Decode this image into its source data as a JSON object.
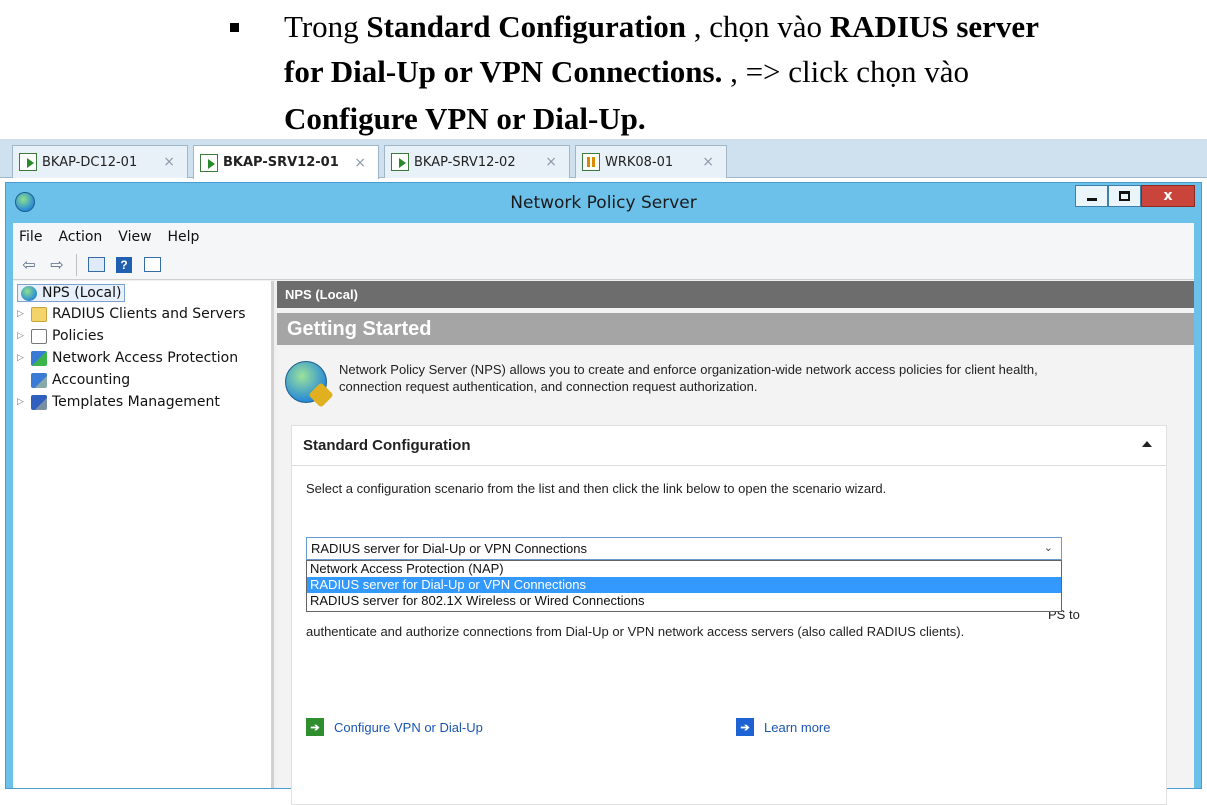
{
  "document": {
    "line1": {
      "t1": "Trong ",
      "b1": "Standard Configuration",
      "t2": " , chọn vào ",
      "b2": "RADIUS server"
    },
    "line2": {
      "b1": "for Dial-Up or VPN Connections.",
      "t1": " , => click chọn vào"
    },
    "line3": {
      "b1": "Configure VPN or Dial-Up."
    }
  },
  "vm_tabs": [
    {
      "label": "BKAP-DC12-01",
      "active": false,
      "state": "running"
    },
    {
      "label": "BKAP-SRV12-01",
      "active": true,
      "state": "running"
    },
    {
      "label": "BKAP-SRV12-02",
      "active": false,
      "state": "running"
    },
    {
      "label": "WRK08-01",
      "active": false,
      "state": "paused"
    }
  ],
  "tab_close_glyph": "×",
  "window": {
    "title": "Network Policy Server",
    "icon": "globe-icon",
    "controls": {
      "close_label": "x"
    }
  },
  "menu": [
    "File",
    "Action",
    "View",
    "Help"
  ],
  "toolbar_icons": [
    "back-arrow-icon",
    "forward-arrow-icon",
    "show-hide-console-tree-icon",
    "help-icon",
    "show-hide-action-pane-icon"
  ],
  "toolbar_glyphs": {
    "back": "⇦",
    "forward": "⇨",
    "help": "?"
  },
  "tree": {
    "root": "NPS (Local)",
    "items": [
      {
        "label": "RADIUS Clients and Servers",
        "icon": "folder-icon",
        "expandable": true
      },
      {
        "label": "Policies",
        "icon": "policies-icon",
        "expandable": true
      },
      {
        "label": "Network Access Protection",
        "icon": "nap-icon",
        "expandable": true
      },
      {
        "label": "Accounting",
        "icon": "accounting-icon",
        "expandable": false
      },
      {
        "label": "Templates Management",
        "icon": "templates-icon",
        "expandable": true
      }
    ]
  },
  "main": {
    "header": "NPS (Local)",
    "getting_started": "Getting Started",
    "intro_line1": "Network Policy Server (NPS) allows you to create and enforce organization-wide network access policies for client health,",
    "intro_line2": "connection request authentication, and connection request authorization.",
    "standard_config": {
      "title": "Standard Configuration",
      "description": "Select a configuration scenario from the list and then click the link below to open the scenario wizard.",
      "selected": "RADIUS server for Dial-Up or VPN Connections",
      "options": [
        "Network Access Protection (NAP)",
        "RADIUS server for Dial-Up or VPN Connections",
        "RADIUS server for 802.1X Wireless or Wired Connections"
      ],
      "selected_index": 1,
      "body_line1_visible_end": "PS to",
      "body_line2": "authenticate and authorize connections from Dial-Up or VPN network access servers (also called RADIUS clients).",
      "link_configure": "Configure VPN or Dial-Up",
      "link_learn": "Learn more"
    }
  }
}
